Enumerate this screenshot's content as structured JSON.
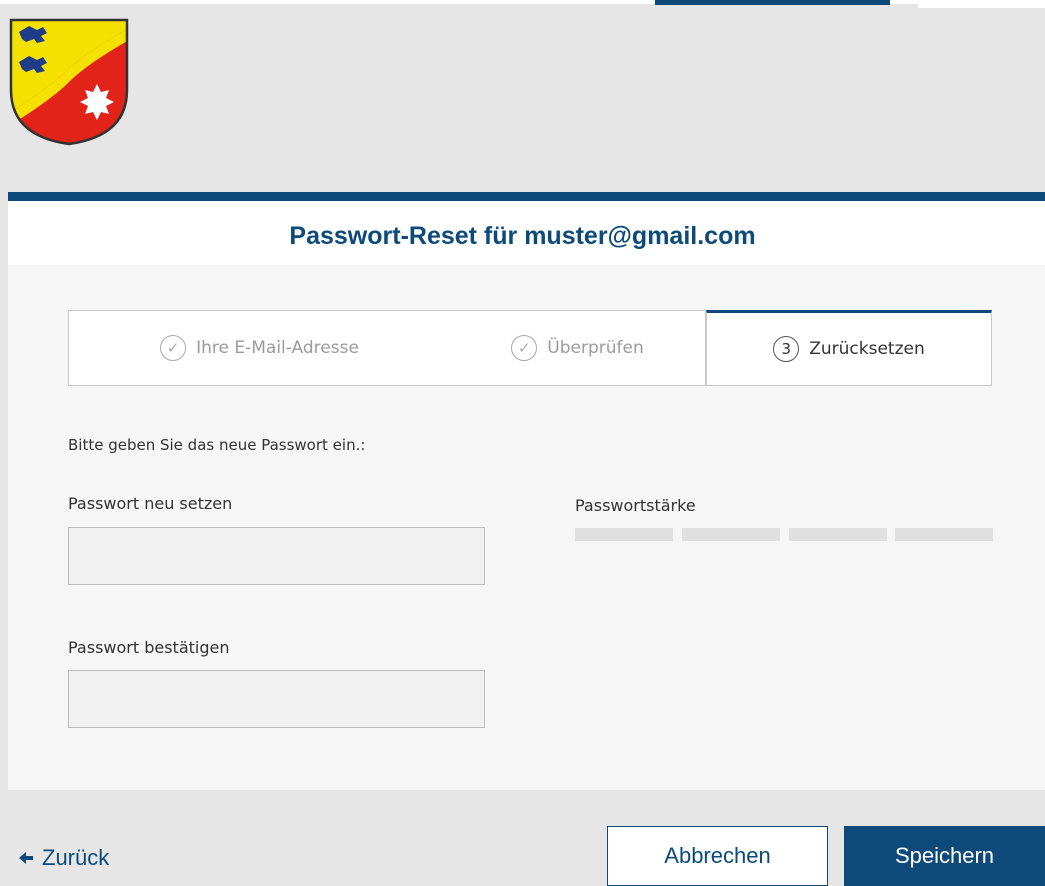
{
  "title": "Passwort-Reset für muster@gmail.com",
  "steps": [
    {
      "badge": "✓",
      "label": "Ihre E-Mail-Adresse",
      "state": "done"
    },
    {
      "badge": "✓",
      "label": "Überprüfen",
      "state": "done"
    },
    {
      "badge": "3",
      "label": "Zurücksetzen",
      "state": "active"
    }
  ],
  "form": {
    "instruction": "Bitte geben Sie das neue Passwort ein.:",
    "new_password_label": "Passwort neu setzen",
    "new_password_value": "",
    "confirm_password_label": "Passwort bestätigen",
    "confirm_password_value": "",
    "strength_label": "Passwortstärke",
    "strength_level": 0
  },
  "footer": {
    "back_label": "Zurück",
    "cancel_label": "Abbrechen",
    "save_label": "Speichern"
  },
  "colors": {
    "primary": "#0d4a7a",
    "page_background": "#e6e6e6",
    "crest_yellow": "#f4e100",
    "crest_red": "#e2231a",
    "crest_blue": "#1f3c8a"
  },
  "icons": {
    "back": "arrow-left-icon",
    "done_step": "check-circle-icon",
    "logo": "coat-of-arms"
  }
}
